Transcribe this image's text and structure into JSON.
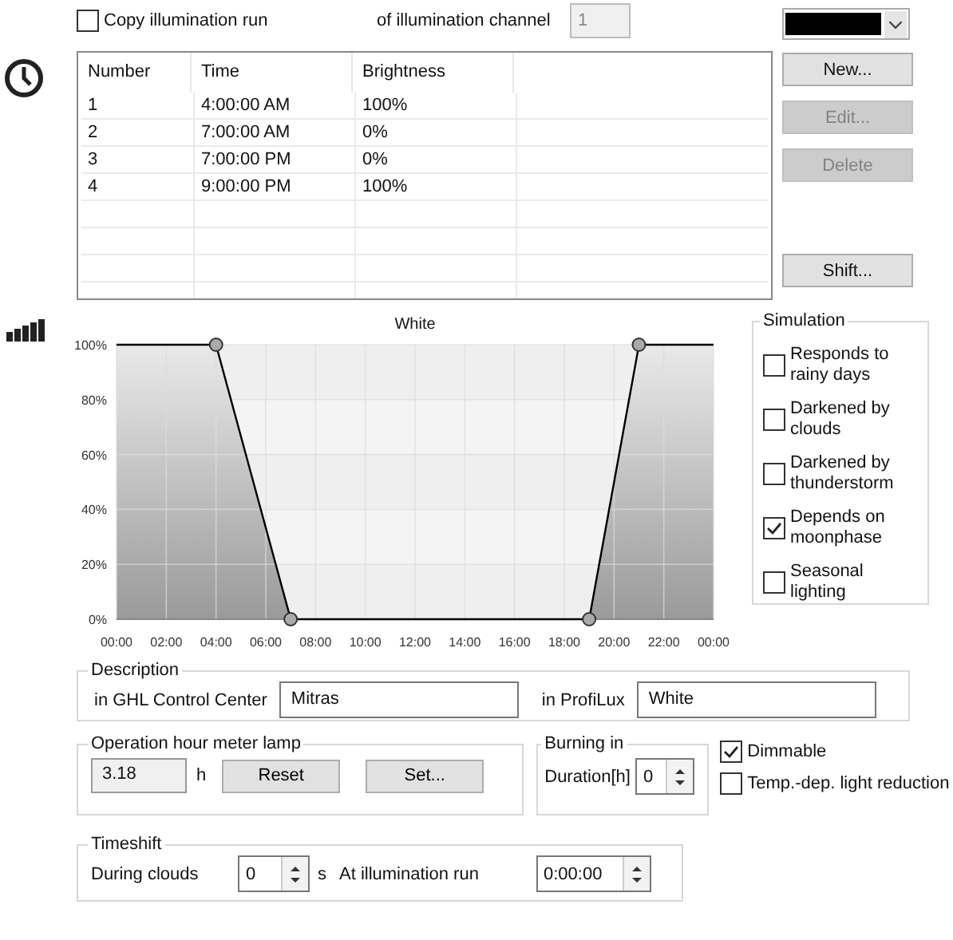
{
  "copy_run": {
    "label": "Copy illumination run",
    "checked": false
  },
  "channel": {
    "label": "of illumination channel",
    "value": "1",
    "disabled": true
  },
  "table": {
    "columns": [
      "Number",
      "Time",
      "Brightness"
    ],
    "rows": [
      [
        "1",
        "4:00:00 AM",
        "100%"
      ],
      [
        "2",
        "7:00:00 AM",
        "0%"
      ],
      [
        "3",
        "7:00:00 PM",
        "0%"
      ],
      [
        "4",
        "9:00:00 PM",
        "100%"
      ]
    ]
  },
  "buttons": [
    {
      "label": "New...",
      "disabled": false
    },
    {
      "label": "Edit...",
      "disabled": true
    },
    {
      "label": "Delete",
      "disabled": true
    },
    {
      "label": "Shift...",
      "disabled": false
    }
  ],
  "chart": {
    "chart_data": {
      "type": "area",
      "grid": true,
      "x": [
        0,
        4,
        7,
        19,
        21,
        24
      ],
      "xlim": [
        0,
        24
      ],
      "ylim": [
        0,
        100
      ],
      "xticks": [
        {
          "value": 0,
          "label": "00:00"
        },
        {
          "value": 2,
          "label": "02:00"
        },
        {
          "value": 4,
          "label": "04:00"
        },
        {
          "value": 6,
          "label": "06:00"
        },
        {
          "value": 8,
          "label": "08:00"
        },
        {
          "value": 10,
          "label": "10:00"
        },
        {
          "value": 12,
          "label": "12:00"
        },
        {
          "value": 14,
          "label": "14:00"
        },
        {
          "value": 16,
          "label": "16:00"
        },
        {
          "value": 18,
          "label": "18:00"
        },
        {
          "value": 20,
          "label": "20:00"
        },
        {
          "value": 22,
          "label": "22:00"
        },
        {
          "value": 24,
          "label": "00:00"
        }
      ],
      "yticks": [
        {
          "value": 0,
          "label": "0%"
        },
        {
          "value": 20,
          "label": "20%"
        },
        {
          "value": 40,
          "label": "40%"
        },
        {
          "value": 60,
          "label": "60%"
        },
        {
          "value": 80,
          "label": "80%"
        },
        {
          "value": 100,
          "label": "100%"
        }
      ],
      "series": [
        {
          "name": "White",
          "color": "#000000",
          "values": [
            100,
            100,
            0,
            0,
            100,
            100
          ]
        }
      ]
    }
  },
  "simulation": {
    "title": "Simulation",
    "options": [
      {
        "label": "Responds to rainy days",
        "checked": false
      },
      {
        "label": "Darkened by clouds",
        "checked": false
      },
      {
        "label": "Darkened by thunderstorm",
        "checked": false
      },
      {
        "label": "Depends on moonphase",
        "checked": true
      },
      {
        "label": "Seasonal lighting",
        "checked": false
      }
    ]
  },
  "description": {
    "title": "Description",
    "fields": [
      {
        "label": "in GHL Control Center",
        "value": "Mitras"
      },
      {
        "label": "in ProfiLux",
        "value": "White"
      }
    ]
  },
  "operation": {
    "title": "Operation hour meter lamp",
    "value": "3.18",
    "unit": "h",
    "buttons": [
      "Reset",
      "Set..."
    ]
  },
  "burning_in": {
    "title": "Burning in",
    "label": "Duration[h]",
    "value": "0"
  },
  "options": [
    {
      "label": "Dimmable",
      "checked": true
    },
    {
      "label": "Temp.-dep. light reduction",
      "checked": false
    }
  ],
  "timeshift": {
    "title": "Timeshift",
    "clouds": {
      "label": "During clouds",
      "value": "0",
      "unit": "s"
    },
    "run": {
      "label": "At illumination run",
      "value": "0:00:00"
    }
  }
}
